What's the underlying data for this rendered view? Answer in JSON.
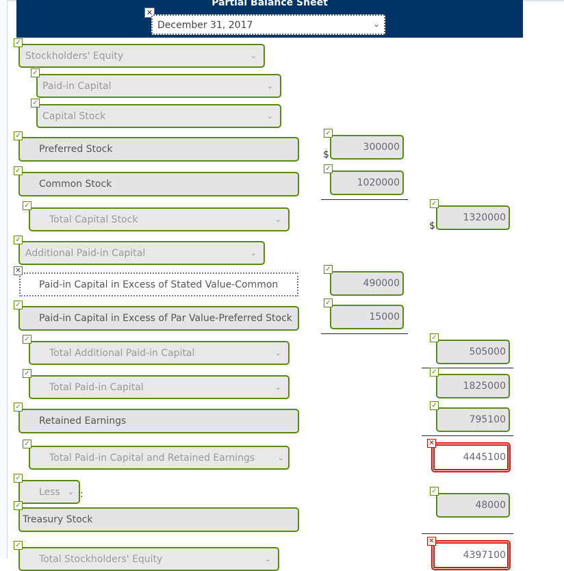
{
  "header": {
    "title": "Partial Balance Sheet",
    "date_selected": "December 31, 2017"
  },
  "status": {
    "correct_icon": "✓",
    "incorrect_icon": "✕"
  },
  "rows": [
    {
      "label": "Stockholders' Equity",
      "kind": "select",
      "status": "correct"
    },
    {
      "label": "Paid-in Capital",
      "kind": "select",
      "status": "correct"
    },
    {
      "label": "Capital Stock",
      "kind": "select",
      "status": "correct"
    },
    {
      "label": "Preferred Stock",
      "kind": "input",
      "status": "correct",
      "amount": "300000",
      "amount_status": "correct",
      "dollar": "$"
    },
    {
      "label": "Common Stock",
      "kind": "input",
      "status": "correct",
      "amount": "1020000",
      "amount_status": "correct"
    },
    {
      "label": "Total Capital Stock",
      "kind": "select",
      "status": "correct",
      "amount": "1320000",
      "amount_status": "correct",
      "dollar": "$"
    },
    {
      "label": "Additional Paid-in Capital",
      "kind": "select",
      "status": "correct"
    },
    {
      "label": "Paid-in Capital in Excess of Stated Value-Common",
      "kind": "input",
      "status": "incorrect",
      "amount": "490000",
      "amount_status": "correct"
    },
    {
      "label": "Paid-in Capital in Excess of Par Value-Preferred Stock",
      "kind": "input",
      "status": "correct",
      "amount": "15000",
      "amount_status": "correct"
    },
    {
      "label": "Total Additional Paid-in Capital",
      "kind": "select",
      "status": "correct",
      "amount": "505000",
      "amount_status": "correct"
    },
    {
      "label": "Total Paid-in Capital",
      "kind": "select",
      "status": "correct",
      "amount": "1825000",
      "amount_status": "correct"
    },
    {
      "label": "Retained Earnings",
      "kind": "input",
      "status": "correct",
      "amount": "795100",
      "amount_status": "correct"
    },
    {
      "label": "Total Paid-in Capital and Retained Earnings",
      "kind": "select",
      "status": "correct",
      "amount": "4445100",
      "amount_status": "incorrect"
    },
    {
      "label": "Less",
      "kind": "select",
      "status": "correct",
      "suffix": ":"
    },
    {
      "label": "Treasury Stock",
      "kind": "input",
      "status": "correct",
      "amount": "48000",
      "amount_status": "correct"
    },
    {
      "label": "Total Stockholders' Equity",
      "kind": "select",
      "status": "correct",
      "amount": "4397100",
      "amount_status": "incorrect"
    }
  ]
}
